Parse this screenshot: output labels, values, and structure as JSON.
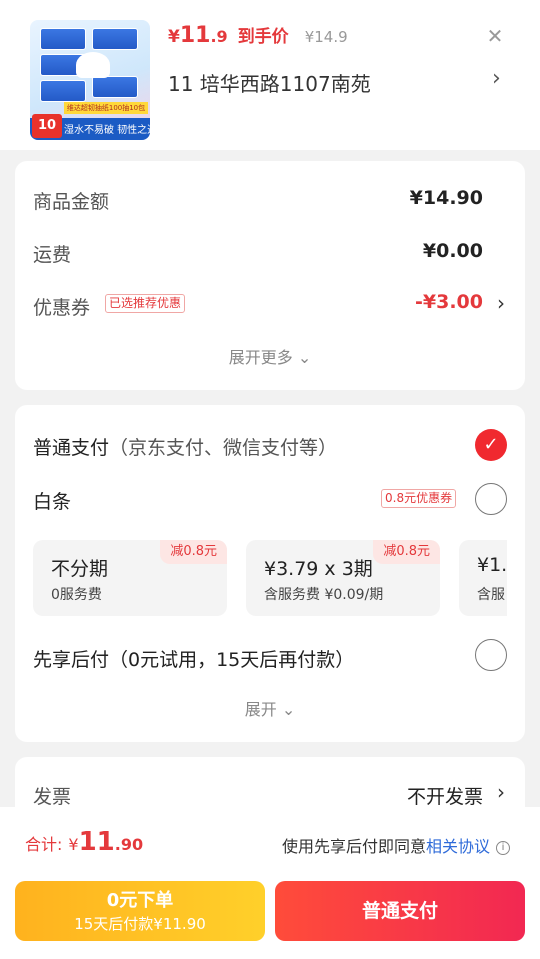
{
  "product": {
    "price_currency": "¥",
    "price_int": "11",
    "price_dec": ".9",
    "price_tag": "到手价",
    "price_old": "¥14.9",
    "address": "11  培华西路1107南苑",
    "thumb_badge_num": "10包",
    "thumb_badge_text": "湿水不易破 韧性之选",
    "thumb_ribbon": "维达超韧抽纸100抽10包"
  },
  "summary": {
    "goods_label": "商品金额",
    "goods_value": "¥14.90",
    "shipping_label": "运费",
    "shipping_value": "¥0.00",
    "coupon_label": "优惠券",
    "coupon_tag": "已选推荐优惠",
    "coupon_value": "-¥3.00",
    "expand_more": "展开更多"
  },
  "payment": {
    "normal_title": "普通支付",
    "normal_sub": "（京东支付、微信支付等）",
    "baitiao_title": "白条",
    "baitiao_tag": "0.8元优惠券",
    "plans": [
      {
        "main": "不分期",
        "sub": "0服务费",
        "discount": "减0.8元"
      },
      {
        "main": "¥3.79 x 3期",
        "sub": "含服务费 ¥0.09/期",
        "discount": "减0.8元"
      },
      {
        "main": "¥1.",
        "sub": "含服",
        "discount": ""
      }
    ],
    "later_title": "先享后付（0元试用，15天后再付款）",
    "expand": "展开"
  },
  "invoice": {
    "label": "发票",
    "value": "不开发票"
  },
  "footer": {
    "total_label": "合计:",
    "total_currency": "¥",
    "total_int": "11",
    "total_dec": ".90",
    "agree_text": "使用先享后付即同意",
    "agree_link": "相关协议",
    "btn_later_line1": "0元下单",
    "btn_later_line2": "15天后付款¥11.90",
    "btn_pay": "普通支付"
  },
  "icons": {
    "close": "close-icon",
    "chevron_right": "chevron-right-icon",
    "chevron_down": "chevron-down-icon",
    "check": "check-icon",
    "info": "info-icon"
  },
  "colors": {
    "accent_red": "#e4393c",
    "pay_button": "#f22852",
    "later_button": "#ffc024",
    "link_blue": "#2f6bd9"
  }
}
